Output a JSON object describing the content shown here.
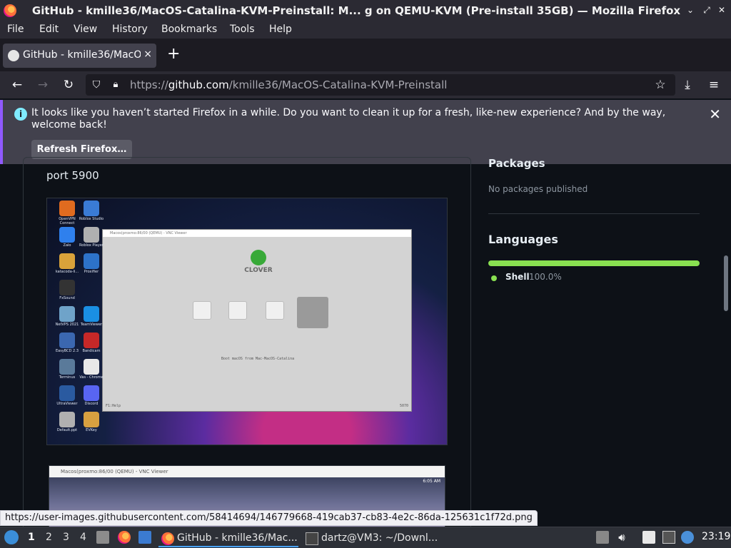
{
  "window": {
    "title": "GitHub - kmille36/MacOS-Catalina-KVM-Preinstall: M... g on QEMU-KVM (Pre-install 35GB) — Mozilla Firefox"
  },
  "menu": [
    "File",
    "Edit",
    "View",
    "History",
    "Bookmarks",
    "Tools",
    "Help"
  ],
  "tab": {
    "label": "GitHub - kmille36/MacOS",
    "close": "×",
    "new_tab": "+"
  },
  "nav": {
    "url_prefix": "https://",
    "url_host": "github.com",
    "url_path": "/kmille36/MacOS-Catalina-KVM-Preinstall"
  },
  "notification": {
    "message": "It looks like you haven’t started Firefox in a while. Do you want to clean it up for a fresh, like-new experience? And by the way, welcome back!",
    "button": "Refresh Firefox…",
    "close": "✕"
  },
  "page": {
    "port_text": "port 5900",
    "sidebar": {
      "packages_heading": "Packages",
      "no_packages": "No packages published",
      "languages_heading": "Languages",
      "language": {
        "name": "Shell",
        "percent": "100.0%",
        "share": 1.0,
        "color": "#89e051"
      }
    },
    "screenshot1": {
      "vnc_title": "Macos(proxmo:86/00 (QEMU) - VNC Viewer",
      "clover": "CLOVER",
      "boot_text": "Boot macOS from Mac-MacOS-Catalina",
      "footer_left": "F1:Help",
      "footer_right": "5070",
      "desktop_icons": [
        "OpenVPN Connect",
        "Roblox Studio",
        "Zalo",
        "Roblox Player",
        "katacoda-li...",
        "Proxifier",
        "FxSound",
        "NetVPS 2021",
        "TeamViewer",
        "EasyBCD 2.3",
        "Bandicam",
        "Terminus",
        "Vas - Chrome",
        "UltraViewer",
        "Discord",
        "Default.ppt",
        "EVKey"
      ]
    },
    "screenshot2": {
      "vnc_title": "Macos(proxmo:86/00 (QEMU) - VNC Viewer",
      "time": "6:05 AM"
    }
  },
  "status_url": "https://user-images.githubusercontent.com/58414694/146779668-419cab37-cb83-4e2c-86da-125631c1f72d.png",
  "taskbar": {
    "workspaces": [
      "1",
      "2",
      "3",
      "4"
    ],
    "tasks": [
      "GitHub - kmille36/Mac...",
      "dartz@VM3: ~/Downl..."
    ],
    "clock": "23:19"
  }
}
